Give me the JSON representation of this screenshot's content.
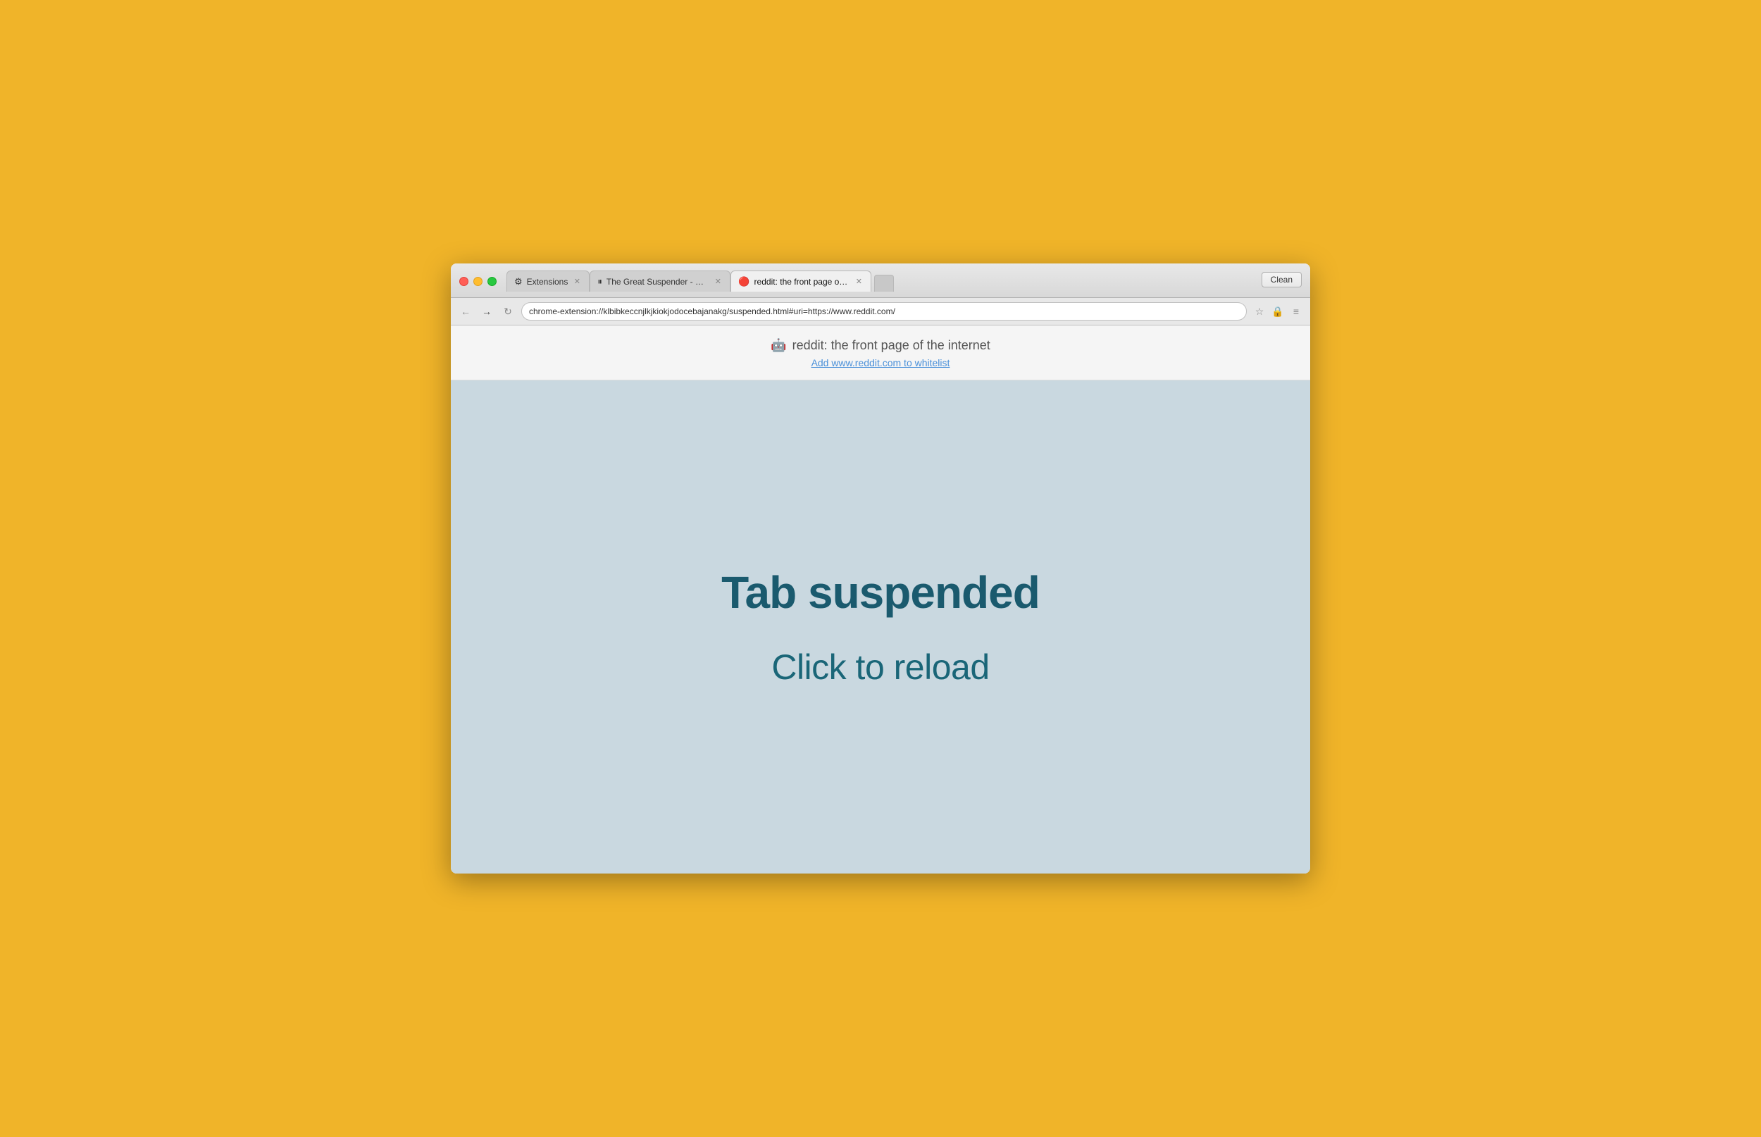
{
  "browser": {
    "clean_button": "Clean",
    "address_url": "chrome-extension://klbibkeccnjlkjkiokjodocebajanakg/suspended.html#uri=https://www.reddit.com/"
  },
  "tabs": [
    {
      "id": "extensions",
      "icon": "⚙",
      "title": "Extensions",
      "active": false,
      "closeable": true
    },
    {
      "id": "great-suspender",
      "icon": "⏸",
      "title": "The Great Suspender - Ch…",
      "active": false,
      "closeable": true
    },
    {
      "id": "reddit",
      "icon": "🔴",
      "title": "reddit: the front page of th…",
      "active": true,
      "closeable": true
    }
  ],
  "page": {
    "site_title": "reddit: the front page of the internet",
    "whitelist_link": "Add www.reddit.com to whitelist",
    "suspended_heading": "Tab suspended",
    "click_to_reload": "Click to reload"
  },
  "icons": {
    "back": "←",
    "forward": "→",
    "reload": "↻",
    "star": "☆",
    "menu": "≡",
    "extension": "🔒"
  }
}
